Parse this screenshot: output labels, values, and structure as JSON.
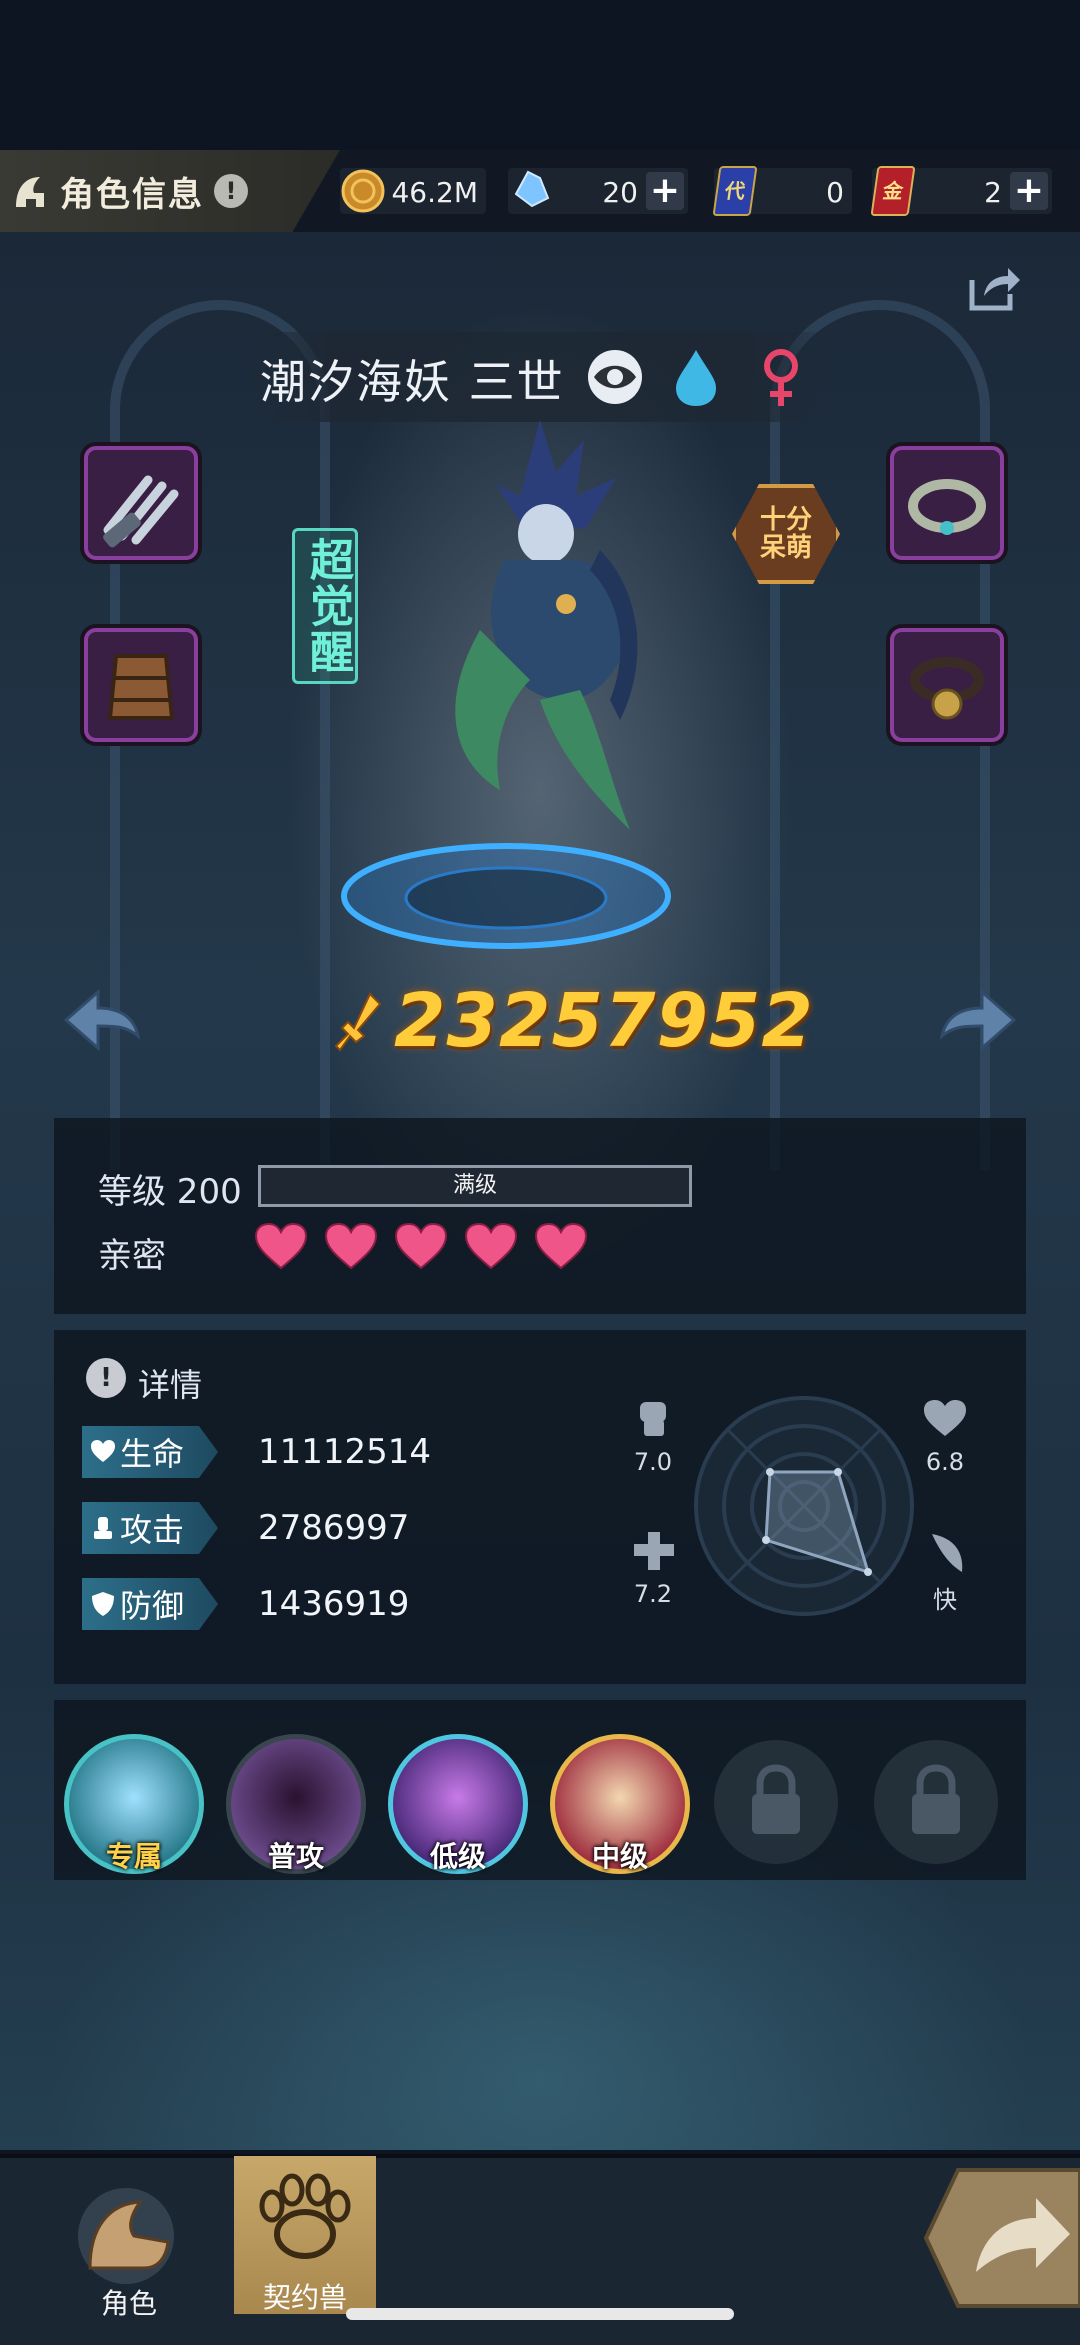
{
  "header": {
    "title": "角色信息",
    "info_badge": "!",
    "resources": [
      {
        "name": "gold-coin",
        "value": "46.2M",
        "has_plus": false
      },
      {
        "name": "crystal",
        "value": "20",
        "has_plus": true
      },
      {
        "name": "ticket-card",
        "icon_text": "代",
        "value": "0",
        "has_plus": false
      },
      {
        "name": "gold-card",
        "icon_text": "金",
        "value": "2",
        "has_plus": true
      }
    ]
  },
  "character": {
    "name": "潮汐海妖 三世",
    "awakening": "超觉醒",
    "trait": "十分呆萌",
    "power": "23257952"
  },
  "level_panel": {
    "level_label": "等级 200",
    "level_bar_text": "满级",
    "level_fill": 1.0,
    "intimacy_label": "亲密",
    "hearts": 5
  },
  "details": {
    "title": "详情",
    "stats": [
      {
        "label": "生命",
        "value": "11112514"
      },
      {
        "label": "攻击",
        "value": "2786997"
      },
      {
        "label": "防御",
        "value": "1436919"
      }
    ],
    "radar": {
      "attack": "7.0",
      "health": "6.8",
      "defense": "7.2",
      "speed": "快"
    }
  },
  "skills": [
    {
      "label": "专属",
      "locked": false
    },
    {
      "label": "普攻",
      "locked": false
    },
    {
      "label": "低级",
      "locked": false
    },
    {
      "label": "中级",
      "locked": false
    },
    {
      "label": "",
      "locked": true
    },
    {
      "label": "",
      "locked": true
    }
  ],
  "nav": {
    "tab_role": "角色",
    "tab_beast": "契约兽"
  },
  "colors": {
    "accent_gold": "#ffcc3a",
    "heart_pink": "#f0558a",
    "equip_purple": "#8a3f9e",
    "awaken_teal": "#58d6c2"
  }
}
